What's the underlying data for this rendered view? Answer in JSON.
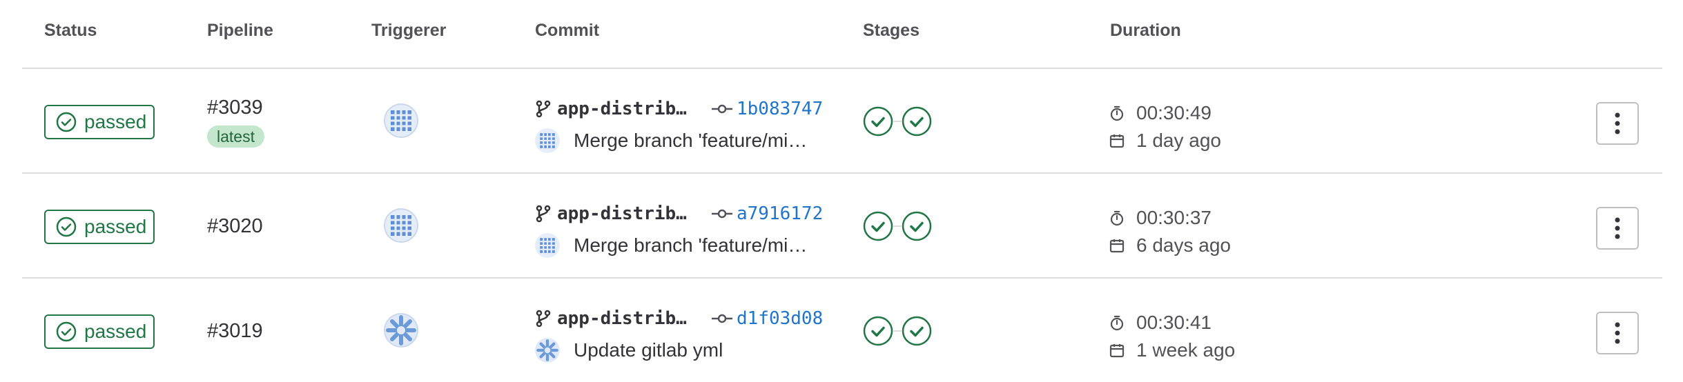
{
  "headers": {
    "status": "Status",
    "pipeline": "Pipeline",
    "triggerer": "Triggerer",
    "commit": "Commit",
    "stages": "Stages",
    "duration": "Duration"
  },
  "colors": {
    "success": "#217645",
    "link": "#1f75cb",
    "latest_bg": "#c3e6cd",
    "border": "#dcdcde"
  },
  "rows": [
    {
      "status": "passed",
      "pipeline_id": "#3039",
      "badge": "latest",
      "triggerer_avatar": "pattern-grid-avatar",
      "branch": "app-distrib…",
      "sha": "1b083747",
      "commit_avatar": "pattern-grid-avatar",
      "commit_title": "Merge branch 'feature/mi…",
      "stages": [
        "passed",
        "passed"
      ],
      "duration": "00:30:49",
      "finished": "1 day ago"
    },
    {
      "status": "passed",
      "pipeline_id": "#3020",
      "badge": "",
      "triggerer_avatar": "pattern-grid-avatar",
      "branch": "app-distrib…",
      "sha": "a7916172",
      "commit_avatar": "pattern-grid-avatar",
      "commit_title": "Merge branch 'feature/mi…",
      "stages": [
        "passed",
        "passed"
      ],
      "duration": "00:30:37",
      "finished": "6 days ago"
    },
    {
      "status": "passed",
      "pipeline_id": "#3019",
      "badge": "",
      "triggerer_avatar": "pattern-snowflake-avatar",
      "branch": "app-distrib…",
      "sha": "d1f03d08",
      "commit_avatar": "pattern-snowflake-avatar",
      "commit_title": "Update gitlab yml",
      "stages": [
        "passed",
        "passed"
      ],
      "duration": "00:30:41",
      "finished": "1 week ago"
    }
  ]
}
